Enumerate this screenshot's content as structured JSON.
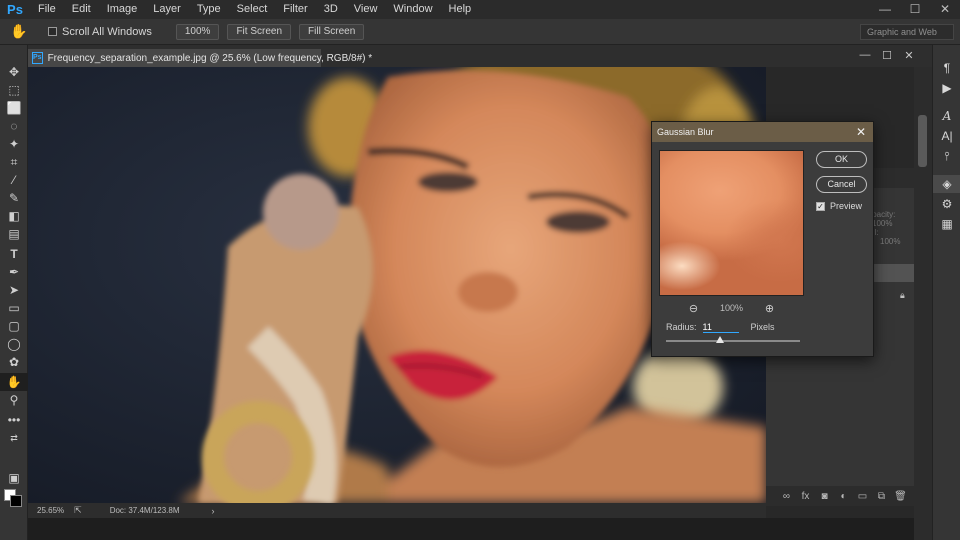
{
  "app": {
    "logo": "Ps"
  },
  "menu": [
    "File",
    "Edit",
    "Image",
    "Layer",
    "Type",
    "Select",
    "Filter",
    "3D",
    "View",
    "Window",
    "Help"
  ],
  "window_controls": {
    "minimize": "—",
    "maximize": "☐",
    "close": "✕"
  },
  "options_bar": {
    "tool_icon": "hand-icon",
    "scroll_all_windows": "Scroll All Windows",
    "zoom_100": "100%",
    "fit_screen": "Fit Screen",
    "fill_screen": "Fill Screen",
    "workspace": "Graphic and Web"
  },
  "document": {
    "tab_title": "Frequency_separation_example.jpg @ 25.6% (Low frequency, RGB/8#) *",
    "controls": {
      "minimize": "—",
      "restore": "☐",
      "close": "✕"
    }
  },
  "toolbar": {
    "tools": [
      "move-icon",
      "artboard-icon",
      "marquee-icon",
      "lasso-icon",
      "magic-wand-icon",
      "crop-icon",
      "eyedropper-icon",
      "brush-icon",
      "eraser-icon",
      "gradient-icon",
      "type-icon",
      "pen-icon",
      "path-selection-icon",
      "rectangle-icon",
      "rounded-rect-icon",
      "ellipse-icon",
      "custom-shape-icon",
      "hand-icon",
      "zoom-icon",
      "more-tools-icon"
    ],
    "active_tool": "hand-icon"
  },
  "status": {
    "zoom": "25.65%",
    "doc_size": "Doc: 37.4M/123.8M"
  },
  "layers_panel": {
    "opacity_label": "Opacity:",
    "opacity_value": "100%",
    "fill_label": "Fill:",
    "fill_value": "100%"
  },
  "dialog": {
    "title": "Gaussian Blur",
    "ok": "OK",
    "cancel": "Cancel",
    "preview_label": "Preview",
    "preview_checked": true,
    "zoom_value": "100%",
    "radius_label": "Radius:",
    "radius_value": "11",
    "radius_unit": "Pixels",
    "slider_fraction": 0.4
  }
}
